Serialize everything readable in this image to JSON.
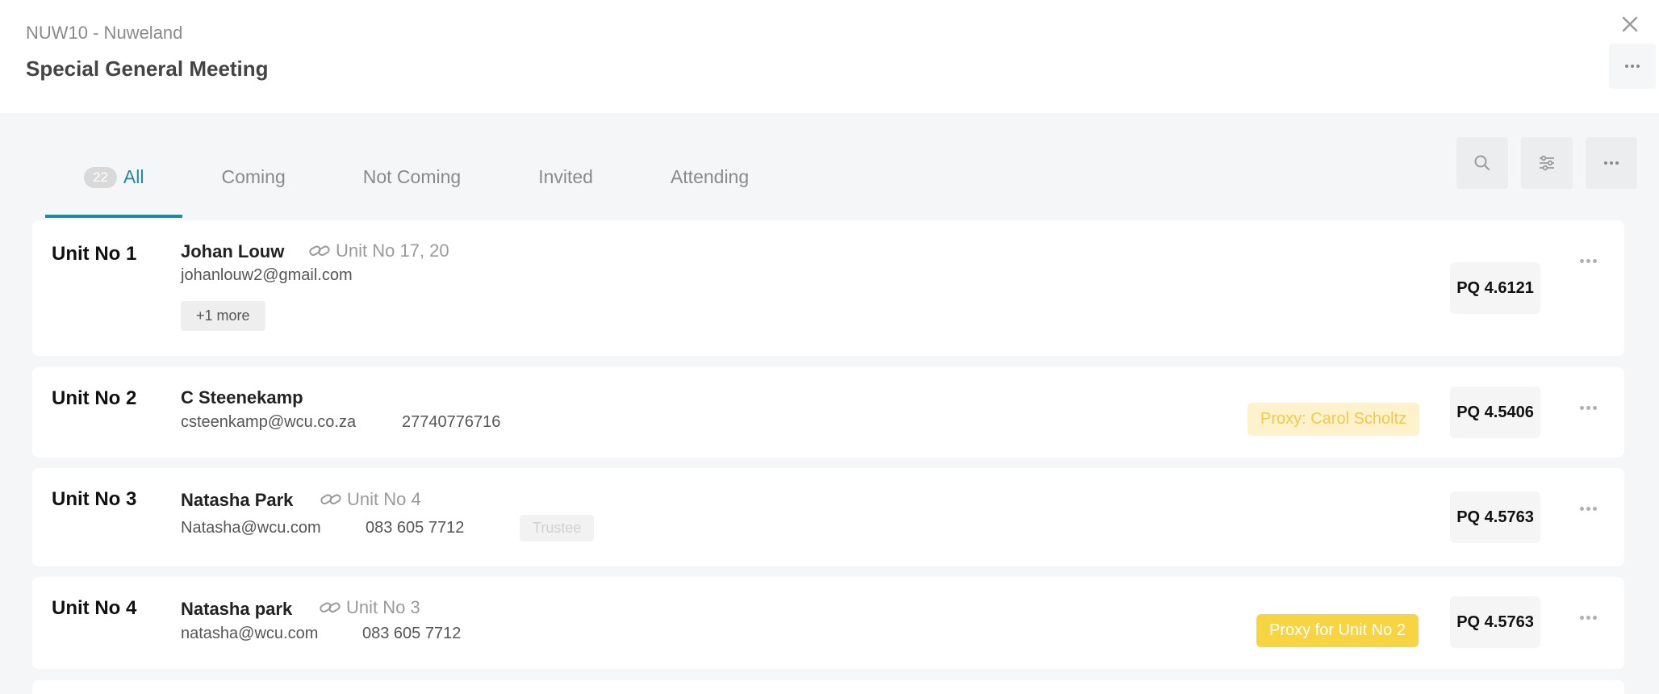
{
  "header": {
    "scheme": "NUW10 - Nuweland",
    "meeting_title": "Special General Meeting"
  },
  "tabs": [
    {
      "label": "All",
      "count": "22",
      "active": true
    },
    {
      "label": "Coming"
    },
    {
      "label": "Not Coming"
    },
    {
      "label": "Invited"
    },
    {
      "label": "Attending"
    }
  ],
  "toolbar": {
    "icons": [
      "search-icon",
      "filter-sliders-icon",
      "more-icon"
    ]
  },
  "rows": [
    {
      "unit": "Unit No 1",
      "name": "Johan Louw",
      "linked_units": "Unit No 17, 20",
      "email": "johanlouw2@gmail.com",
      "more_chip": "+1 more",
      "pq": "PQ 4.6121"
    },
    {
      "unit": "Unit No 2",
      "name": "C Steenekamp",
      "email": "csteenkamp@wcu.co.za",
      "phone": "27740776716",
      "tag": "Proxy: Carol Scholtz",
      "pq": "PQ 4.5406"
    },
    {
      "unit": "Unit No 3",
      "name": "Natasha Park",
      "linked_units": "Unit No 4",
      "email": "Natasha@wcu.com",
      "phone": "083 605 7712",
      "role": "Trustee",
      "pq": "PQ 4.5763"
    },
    {
      "unit": "Unit No 4",
      "name": "Natasha park",
      "linked_units": "Unit No 3",
      "email": "natasha@wcu.com",
      "phone": "083 605 7712",
      "tag": "Proxy for Unit No 2",
      "pq": "PQ 4.5763"
    }
  ],
  "colors": {
    "accent": "#1f8aa0",
    "proxy_light_bg": "#fdf2cc",
    "proxy_light_text": "#f2c94c",
    "proxy_solid_bg": "#f6d442"
  }
}
